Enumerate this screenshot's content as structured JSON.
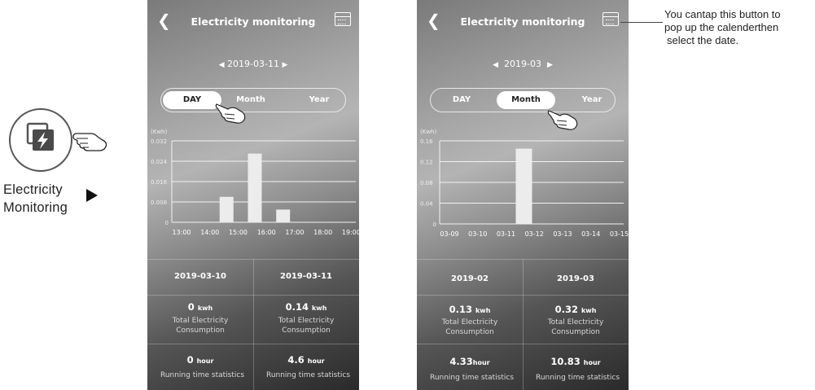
{
  "legend": {
    "label_line1": "Electricity",
    "label_line2": "Monitoring",
    "icon": "electricity-monitor-icon"
  },
  "note": {
    "line1": "You cantap this button to",
    "line2": "pop up the calenderthen",
    "line3": "select the date."
  },
  "phone1": {
    "title": "Electricity monitoring",
    "date": "2019-03-11",
    "tabs": [
      "DAY",
      "Month",
      "Year"
    ],
    "active_tab": "DAY",
    "table": {
      "col1_header": "2019-03-10",
      "col2_header": "2019-03-11",
      "col1_energy_value": "0",
      "col1_energy_unit": "kwh",
      "col2_energy_value": "0.14",
      "col2_energy_unit": "kwh",
      "energy_label_line1": "Total Electricity",
      "energy_label_line2": "Consumption",
      "col1_time_value": "0",
      "col1_time_unit": "hour",
      "col2_time_value": "4.6",
      "col2_time_unit": "hour",
      "time_label": "Running time statistics"
    }
  },
  "phone2": {
    "title": "Electricity monitoring",
    "date": "2019-03",
    "tabs": [
      "DAY",
      "Month",
      "Year"
    ],
    "active_tab": "Month",
    "table": {
      "col1_header": "2019-02",
      "col2_header": "2019-03",
      "col1_energy_value": "0.13",
      "col1_energy_unit": "kwh",
      "col2_energy_value": "0.32",
      "col2_energy_unit": "kwh",
      "energy_label_line1": "Total Electricity",
      "energy_label_line2": "Consumption",
      "col1_time_value": "4.33",
      "col1_time_unit": "hour",
      "col2_time_value": "10.83",
      "col2_time_unit": "hour",
      "time_label": "Running time statistics"
    }
  },
  "chart_data": [
    {
      "type": "bar",
      "ylabel": "(Kwh)",
      "categories": [
        "13:00",
        "14:00",
        "15:00",
        "16:00",
        "17:00",
        "18:00",
        "19:00"
      ],
      "values": [
        0,
        0.01,
        0.027,
        0.005,
        0,
        0,
        0
      ],
      "y_ticks": [
        "0",
        "0.008",
        "0.016",
        "0.024",
        "0.032"
      ],
      "ylim": [
        0,
        0.032
      ],
      "grid": true
    },
    {
      "type": "bar",
      "ylabel": "(Kwh)",
      "categories": [
        "03-09",
        "03-10",
        "03-11",
        "03-12",
        "03-13",
        "03-14",
        "03-15"
      ],
      "values": [
        0,
        0,
        0.145,
        0,
        0,
        0,
        0
      ],
      "y_ticks": [
        "0",
        "0.04",
        "0.08",
        "0.12",
        "0.16"
      ],
      "ylim": [
        0,
        0.16
      ],
      "grid": true
    }
  ]
}
